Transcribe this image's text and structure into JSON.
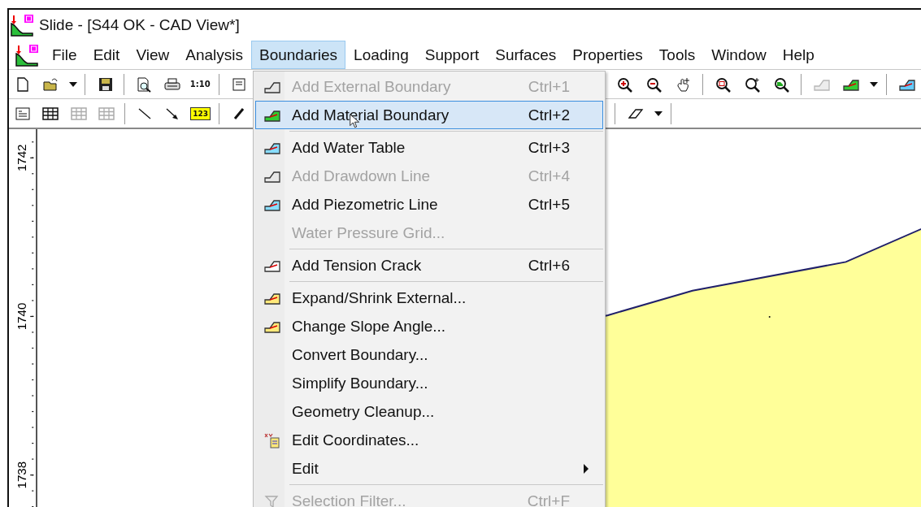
{
  "window": {
    "title": "Slide - [S44 OK - CAD View*]"
  },
  "menu_bar": [
    {
      "label": "File",
      "selected": false
    },
    {
      "label": "Edit",
      "selected": false
    },
    {
      "label": "View",
      "selected": false
    },
    {
      "label": "Analysis",
      "selected": false
    },
    {
      "label": "Boundaries",
      "selected": true
    },
    {
      "label": "Loading",
      "selected": false
    },
    {
      "label": "Support",
      "selected": false
    },
    {
      "label": "Surfaces",
      "selected": false
    },
    {
      "label": "Properties",
      "selected": false
    },
    {
      "label": "Tools",
      "selected": false
    },
    {
      "label": "Window",
      "selected": false
    },
    {
      "label": "Help",
      "selected": false
    }
  ],
  "toolbars": [
    {
      "left": [
        {
          "kind": "button",
          "disabled": false
        },
        {
          "kind": "button",
          "disabled": false
        },
        {
          "kind": "dropdown",
          "disabled": false
        },
        {
          "kind": "separator"
        },
        {
          "kind": "button",
          "disabled": false
        },
        {
          "kind": "separator"
        },
        {
          "kind": "button",
          "disabled": false
        },
        {
          "kind": "button",
          "disabled": false
        },
        {
          "kind": "text",
          "label": "1:10",
          "disabled": false
        },
        {
          "kind": "separator"
        },
        {
          "kind": "button",
          "disabled": false
        }
      ],
      "right": [
        {
          "kind": "button",
          "disabled": false
        },
        {
          "kind": "button",
          "disabled": false
        },
        {
          "kind": "button",
          "disabled": false
        },
        {
          "kind": "separator"
        },
        {
          "kind": "button",
          "disabled": false
        },
        {
          "kind": "button",
          "disabled": false
        },
        {
          "kind": "button",
          "disabled": false
        },
        {
          "kind": "separator"
        },
        {
          "kind": "button",
          "disabled": true
        },
        {
          "kind": "button",
          "disabled": false
        },
        {
          "kind": "dropdown",
          "disabled": false
        },
        {
          "kind": "separator"
        },
        {
          "kind": "button",
          "disabled": false
        }
      ]
    },
    {
      "left": [
        {
          "kind": "button",
          "disabled": false
        },
        {
          "kind": "button",
          "disabled": false
        },
        {
          "kind": "button",
          "disabled": true
        },
        {
          "kind": "button",
          "disabled": true
        },
        {
          "kind": "separator"
        },
        {
          "kind": "button",
          "disabled": false
        },
        {
          "kind": "button",
          "disabled": false
        },
        {
          "kind": "text",
          "label": "123",
          "disabled": false
        },
        {
          "kind": "separator"
        },
        {
          "kind": "button",
          "disabled": false
        }
      ],
      "right": [
        {
          "kind": "separator"
        },
        {
          "kind": "button",
          "disabled": false
        },
        {
          "kind": "dropdown",
          "disabled": false
        },
        {
          "kind": "separator"
        }
      ]
    }
  ],
  "boundaries_menu": [
    {
      "kind": "item",
      "label": "Add External Boundary",
      "shortcut": "Ctrl+1",
      "disabled": true,
      "selected": false,
      "submenu": false
    },
    {
      "kind": "item",
      "label": "Add Material Boundary",
      "shortcut": "Ctrl+2",
      "disabled": false,
      "selected": true,
      "submenu": false
    },
    {
      "kind": "separator"
    },
    {
      "kind": "item",
      "label": "Add Water Table",
      "shortcut": "Ctrl+3",
      "disabled": false,
      "selected": false,
      "submenu": false
    },
    {
      "kind": "item",
      "label": "Add Drawdown Line",
      "shortcut": "Ctrl+4",
      "disabled": true,
      "selected": false,
      "submenu": false
    },
    {
      "kind": "item",
      "label": "Add Piezometric Line",
      "shortcut": "Ctrl+5",
      "disabled": false,
      "selected": false,
      "submenu": false
    },
    {
      "kind": "item",
      "label": "Water Pressure Grid...",
      "disabled": true,
      "selected": false,
      "submenu": false
    },
    {
      "kind": "separator"
    },
    {
      "kind": "item",
      "label": "Add Tension Crack",
      "shortcut": "Ctrl+6",
      "disabled": false,
      "selected": false,
      "submenu": false
    },
    {
      "kind": "separator"
    },
    {
      "kind": "item",
      "label": "Expand/Shrink External...",
      "disabled": false,
      "selected": false,
      "submenu": false
    },
    {
      "kind": "item",
      "label": "Change Slope Angle...",
      "disabled": false,
      "selected": false,
      "submenu": false
    },
    {
      "kind": "item",
      "label": "Convert Boundary...",
      "disabled": false,
      "selected": false,
      "submenu": false
    },
    {
      "kind": "item",
      "label": "Simplify Boundary...",
      "disabled": false,
      "selected": false,
      "submenu": false
    },
    {
      "kind": "item",
      "label": "Geometry Cleanup...",
      "disabled": false,
      "selected": false,
      "submenu": false
    },
    {
      "kind": "item",
      "label": "Edit Coordinates...",
      "disabled": false,
      "selected": false,
      "submenu": false
    },
    {
      "kind": "item",
      "label": "Edit",
      "disabled": false,
      "selected": false,
      "submenu": true
    },
    {
      "kind": "separator"
    },
    {
      "kind": "item",
      "label": "Selection Filter...",
      "shortcut": "Ctrl+F",
      "disabled": true,
      "selected": false,
      "submenu": false
    }
  ],
  "ruler": {
    "labels": [
      "1742",
      "1740",
      "1738"
    ]
  }
}
